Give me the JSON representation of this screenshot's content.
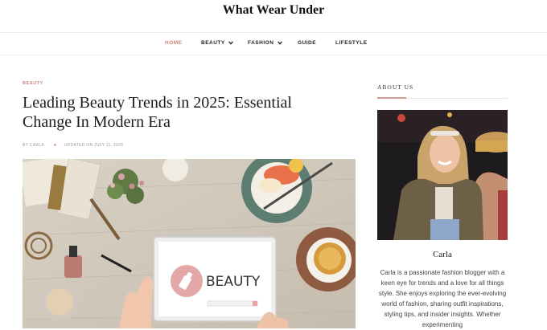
{
  "site": {
    "title": "What Wear Under"
  },
  "nav": {
    "items": [
      {
        "label": "HOME",
        "active": true,
        "has_dropdown": false
      },
      {
        "label": "BEAUTY",
        "active": false,
        "has_dropdown": true
      },
      {
        "label": "FASHION",
        "active": false,
        "has_dropdown": true
      },
      {
        "label": "GUIDE",
        "active": false,
        "has_dropdown": false
      },
      {
        "label": "LIFESTYLE",
        "active": false,
        "has_dropdown": false
      }
    ]
  },
  "post": {
    "category": "BEAUTY",
    "title": "Leading Beauty Trends in 2025: Essential Change In Modern Era",
    "author": "BY CARLA",
    "updated": "UPDATED ON JULY 11, 2025",
    "hero_text": "BEAUTY"
  },
  "sidebar": {
    "heading": "ABOUT US",
    "author_name": "Carla",
    "bio": "Carla is a passionate fashion blogger with a keen eye for trends and a love for all things style. She enjoys exploring the ever-evolving world of fashion, sharing outfit inspirations, styling tips, and insider insights. Whether experimenting"
  },
  "colors": {
    "accent": "#c9867d",
    "text": "#222222",
    "muted": "#999999"
  },
  "icons": {
    "dropdown": "chevron-down-icon",
    "tablet_logo": "lipstick-icon"
  }
}
